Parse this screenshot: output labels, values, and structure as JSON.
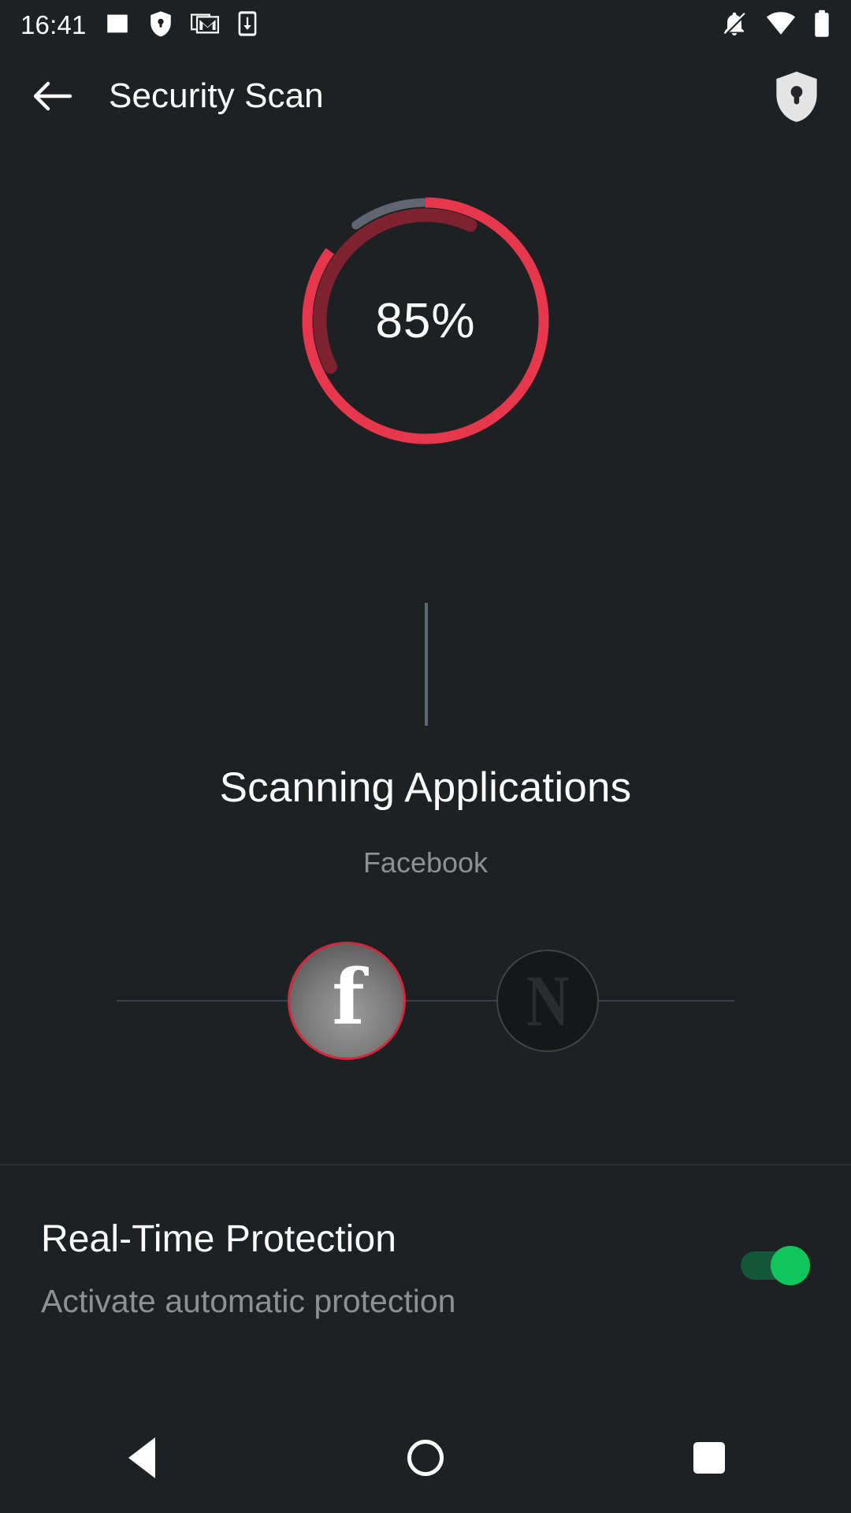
{
  "status_bar": {
    "time": "16:41",
    "left_icons": [
      "image-icon",
      "shield-lock-icon",
      "gmail-icon",
      "phone-download-icon"
    ],
    "right_icons": [
      "notifications-off-icon",
      "wifi-icon",
      "battery-full-icon"
    ]
  },
  "app_bar": {
    "back_icon": "back-arrow-icon",
    "title": "Security Scan",
    "action_icon": "shield-keyhole-icon"
  },
  "scan": {
    "progress_label": "85%",
    "progress_percent": 85,
    "ring_colors": {
      "progress": "#E8364C",
      "track": "#5F6571",
      "inner_arc": "#7E2230",
      "background": "#1E2124"
    },
    "title": "Scanning Applications",
    "subtitle": "Facebook",
    "connector_color": "#5F6571",
    "apps": [
      {
        "name": "Facebook",
        "glyph": "f",
        "state": "scanning",
        "highlight_color": "#D8273C"
      },
      {
        "name": "Netflix",
        "glyph": "N",
        "state": "pending",
        "highlight_color": "#3E444C"
      }
    ]
  },
  "settings": {
    "title": "Real-Time Protection",
    "subtitle": "Activate automatic protection",
    "toggle": {
      "name": "real-time-protection-toggle",
      "state": "on",
      "on_color": "#10C55B",
      "track_color": "#14573B"
    }
  },
  "nav_bar": {
    "buttons": [
      "back-nav-button",
      "home-nav-button",
      "recents-nav-button"
    ]
  }
}
